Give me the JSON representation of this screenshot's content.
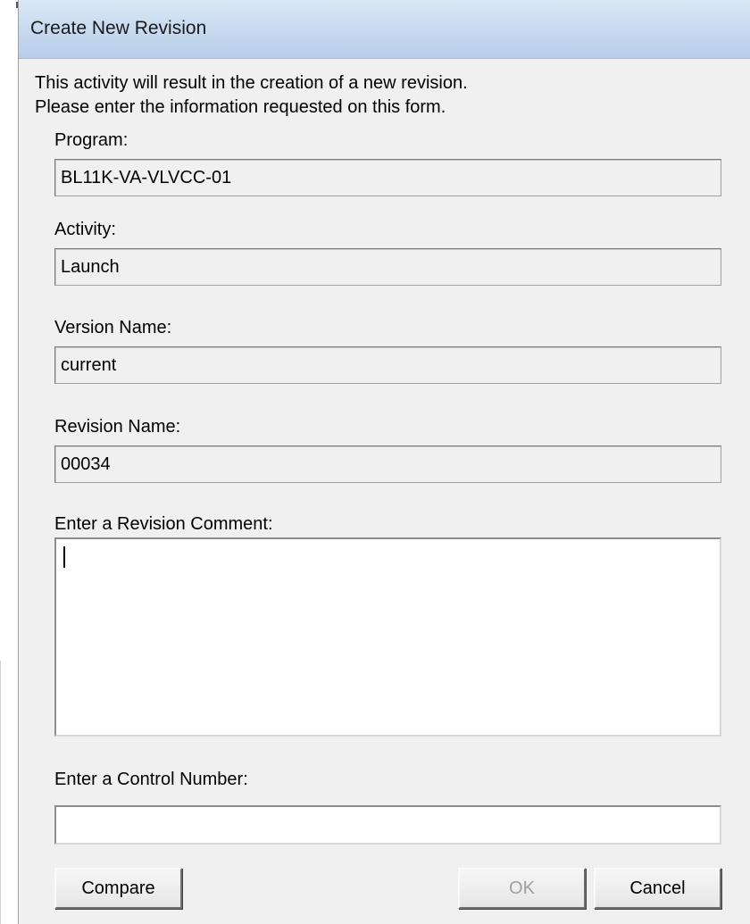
{
  "window": {
    "title": "Create New Revision"
  },
  "intro": {
    "line1": "This activity will result in the creation of a new revision.",
    "line2": "Please enter the information requested on this form."
  },
  "fields": {
    "program": {
      "label": "Program:",
      "value": "BL11K-VA-VLVCC-01"
    },
    "activity": {
      "label": "Activity:",
      "value": "Launch"
    },
    "version_name": {
      "label": "Version Name:",
      "value": "current"
    },
    "revision_name": {
      "label": "Revision Name:",
      "value": "00034"
    },
    "revision_comment": {
      "label": "Enter a Revision Comment:",
      "value": ""
    },
    "control_number": {
      "label": "Enter a Control Number:",
      "value": ""
    }
  },
  "buttons": {
    "compare": "Compare",
    "ok": "OK",
    "cancel": "Cancel"
  },
  "colors": {
    "titlebar": "#c6d9ef",
    "dialog_background": "#f0f0f0",
    "disabled_text": "#a0a0a0"
  }
}
